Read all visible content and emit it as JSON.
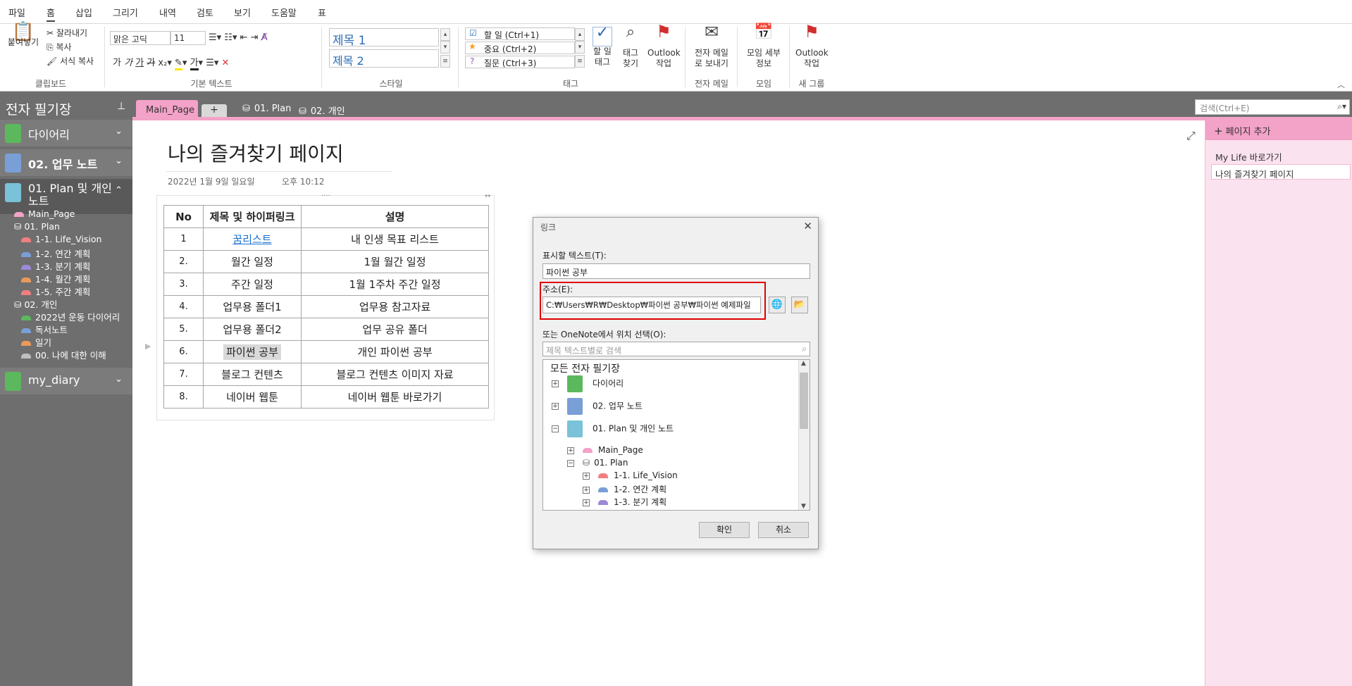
{
  "menu": [
    "파일",
    "홈",
    "삽입",
    "그리기",
    "내역",
    "검토",
    "보기",
    "도움말",
    "표"
  ],
  "ribbon": {
    "clipboard": {
      "paste": "붙여넣기",
      "cut": "잘라내기",
      "copy": "복사",
      "format_copy": "서식 복사",
      "label": "클립보드"
    },
    "basic_text": {
      "font": "맑은 고딕",
      "size": "11",
      "label": "기본 텍스트"
    },
    "styles": {
      "h1": "제목 1",
      "h2": "제목 2",
      "label": "스타일"
    },
    "tags": {
      "todo": "할 일 (Ctrl+1)",
      "important": "중요 (Ctrl+2)",
      "question": "질문 (Ctrl+3)",
      "todo_tag": "할 일 태그",
      "find_tags": "태그 찾기",
      "outlook_task": "Outlook 작업",
      "label": "태그"
    },
    "email": {
      "send": "전자 메일로 보내기",
      "label": "전자 메일"
    },
    "meetings": {
      "details": "모임 세부 정보",
      "label": "모임"
    },
    "new_group": {
      "outlook_task": "Outlook 작업",
      "label": "새 그룹"
    }
  },
  "nav": {
    "title": "전자 필기장",
    "notebooks": [
      {
        "name": "다이어리",
        "color": "#5cb85c"
      },
      {
        "name": "02. 업무 노트",
        "color": "#7a9ed6"
      },
      {
        "name": "01. Plan 및 개인 노트",
        "color": "#79c2d8"
      },
      {
        "name": "my_diary",
        "color": "#5cb85c"
      }
    ],
    "sections": [
      "Main_Page",
      "01. Plan",
      "1-1. Life_Vision",
      "1-2. 연간 계획",
      "1-3. 분기 계획",
      "1-4. 월간 계획",
      "1-5. 주간 계획",
      "02. 개인",
      "2022년 운동 다이어리",
      "독서노트",
      "일기",
      "00. 나에 대한 이해"
    ]
  },
  "tabs": {
    "main": "Main_Page",
    "add": "+",
    "plan": "01. Plan",
    "personal": "02. 개인",
    "search_placeholder": "검색(Ctrl+E)"
  },
  "page": {
    "title": "나의 즐겨찾기 페이지",
    "date": "2022년 1월 9일 일요일",
    "time": "오후 10:12",
    "table": {
      "headers": [
        "No",
        "제목 및 하이퍼링크",
        "설명"
      ],
      "rows": [
        [
          "1",
          "꿈리스트",
          "내 인생 목표 리스트"
        ],
        [
          "2.",
          "월간 일정",
          "1월 월간 일정"
        ],
        [
          "3.",
          "주간 일정",
          "1월 1주차 주간 일정"
        ],
        [
          "4.",
          "업무용 폴더1",
          "업무용 참고자료"
        ],
        [
          "5.",
          "업무용 폴더2",
          "업무 공유 폴더"
        ],
        [
          "6.",
          "파이썬 공부",
          "개인 파이썬 공부"
        ],
        [
          "7.",
          "블로그 컨텐츠",
          "블로그 컨텐츠 이미지 자료"
        ],
        [
          "8.",
          "네이버 웹툰",
          "네이버 웹툰 바로가기"
        ]
      ]
    }
  },
  "right_panel": {
    "add_page": "페이지 추가",
    "pages": [
      "My Life 바로가기",
      "나의 즐겨찾기 페이지"
    ]
  },
  "dialog": {
    "title": "링크",
    "display_text_label": "표시할 텍스트(T):",
    "display_text_value": "파이썬 공부",
    "address_label": "주소(E):",
    "address_value": "C:₩Users₩R₩Desktop₩파이썬 공부₩파이썬 예제파일",
    "onenote_label": "또는 OneNote에서 위치 선택(O):",
    "search_placeholder": "제목 텍스트별로 검색",
    "tree_root": "모든 전자 필기장",
    "tree": [
      "다이어리",
      "02. 업무 노트",
      "01. Plan 및 개인 노트",
      "Main_Page",
      "01. Plan",
      "1-1. Life_Vision",
      "1-2. 연간 계획",
      "1-3. 분기 계획"
    ],
    "ok": "확인",
    "cancel": "취소"
  }
}
